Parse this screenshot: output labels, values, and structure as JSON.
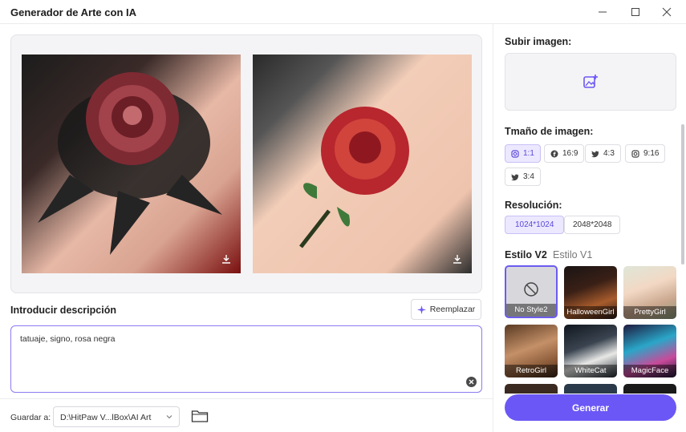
{
  "window": {
    "title": "Generador de Arte con IA"
  },
  "description": {
    "label": "Introducir descripción",
    "replace_label": "Reemplazar",
    "text": "tatuaje, signo, rosa negra"
  },
  "save": {
    "label": "Guardar a:",
    "path": "D:\\HitPaw V...lBox\\AI Art"
  },
  "sidebar": {
    "upload_label": "Subir imagen:",
    "size_label": "Tmaño de imagen:",
    "sizes": [
      {
        "label": "1:1",
        "icon": "instagram-icon",
        "selected": true
      },
      {
        "label": "16:9",
        "icon": "facebook-icon",
        "selected": false
      },
      {
        "label": "4:3",
        "icon": "twitter-icon",
        "selected": false
      },
      {
        "label": "9:16",
        "icon": "instagram-icon",
        "selected": false
      },
      {
        "label": "3:4",
        "icon": "twitter-icon",
        "selected": false
      }
    ],
    "resolution_label": "Resolución:",
    "resolutions": [
      {
        "label": "1024*1024",
        "selected": true
      },
      {
        "label": "2048*2048",
        "selected": false
      }
    ],
    "style_tabs": [
      {
        "label": "Estilo V2",
        "active": true
      },
      {
        "label": "Estilo V1",
        "active": false
      }
    ],
    "styles": [
      {
        "label": "No Style2",
        "selected": true
      },
      {
        "label": "HalloweenGirl"
      },
      {
        "label": "PrettyGirl"
      },
      {
        "label": "RetroGirl"
      },
      {
        "label": "WhiteCat"
      },
      {
        "label": "MagicFace"
      }
    ],
    "generate_label": "Generar"
  },
  "colors": {
    "accent": "#6b57f5",
    "selected_bg": "#ece8ff"
  }
}
